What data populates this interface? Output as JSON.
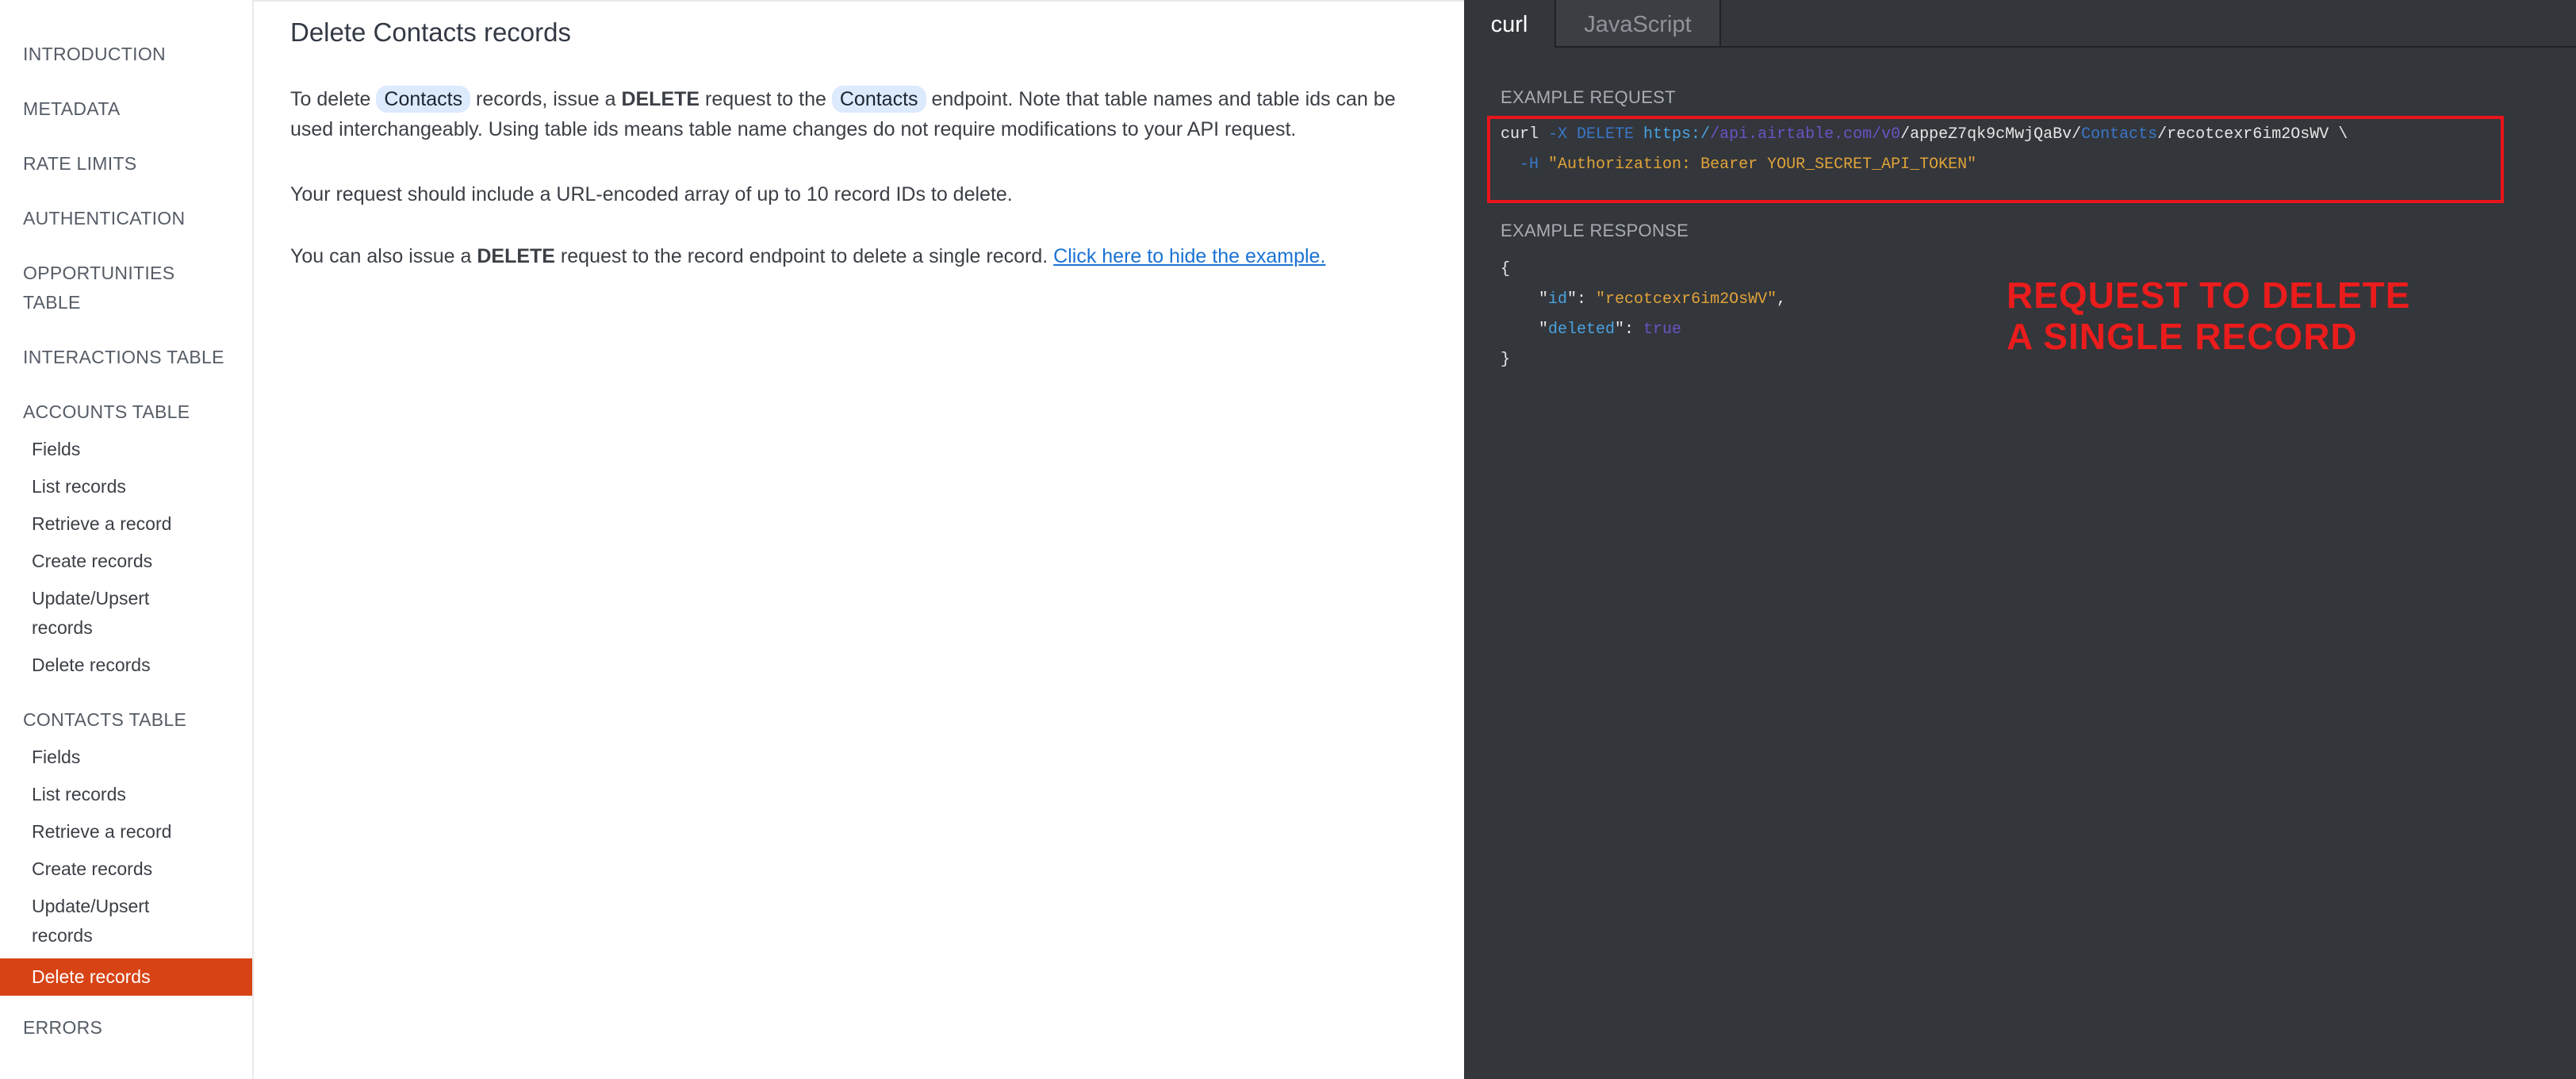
{
  "sidebar": {
    "sections": [
      {
        "label": "INTRODUCTION"
      },
      {
        "label": "METADATA"
      },
      {
        "label": "RATE LIMITS"
      },
      {
        "label": "AUTHENTICATION"
      },
      {
        "label_line1": "OPPORTUNITIES",
        "label_line2": "TABLE"
      },
      {
        "label": "INTERACTIONS TABLE"
      },
      {
        "label": "ACCOUNTS TABLE",
        "items": [
          "Fields",
          "List records",
          "Retrieve a record",
          "Create records",
          "Update/Upsert",
          "records",
          "Delete records"
        ]
      },
      {
        "label": "CONTACTS TABLE",
        "items": [
          "Fields",
          "List records",
          "Retrieve a record",
          "Create records",
          "Update/Upsert",
          "records",
          "Delete records"
        ]
      },
      {
        "label": "ERRORS"
      }
    ],
    "active_item": "Delete records",
    "active_color": "#d84315"
  },
  "main": {
    "title": "Delete Contacts records",
    "p1": {
      "t1": "To delete ",
      "pill1": "Contacts",
      "t2": " records, issue a ",
      "bold1": "DELETE",
      "t3": " request to the ",
      "pill2": "Contacts",
      "t4": " endpoint. Note that table names and table ids can be used interchangeably. Using table ids means table name changes do not require modifications to your API request."
    },
    "p2": "Your request should include a URL-encoded array of up to 10 record IDs to delete.",
    "p3": {
      "t1": "You can also issue a ",
      "bold1": "DELETE",
      "t2": " request to the record endpoint to delete a single record. ",
      "link": "Click here to hide the example."
    }
  },
  "code_panel": {
    "tabs": [
      "curl",
      "JavaScript"
    ],
    "active_tab": "curl",
    "example_request_label": "EXAMPLE REQUEST",
    "example_response_label": "EXAMPLE RESPONSE",
    "request": {
      "cmd": "curl ",
      "flag_x": "-X",
      "method": " DELETE",
      "scheme": " https:/",
      "host": "/api.airtable.com/v0",
      "base": "/appeZ7qk9cMwjQaBv/",
      "table": "Contacts",
      "record": "/recotcexr6im2OsWV \\",
      "indent2": "  ",
      "flag_h": "-H",
      "header": " \"Authorization: Bearer YOUR_SECRET_API_TOKEN\""
    },
    "response": {
      "open": "{",
      "id_key": "id",
      "id_val": "\"recotcexr6im2OsWV\"",
      "deleted_key": "deleted",
      "deleted_val": "true",
      "close": "}"
    },
    "annotation": {
      "line1": "REQUEST TO DELETE",
      "line2": "A SINGLE RECORD",
      "color": "#ea1c1c"
    }
  }
}
